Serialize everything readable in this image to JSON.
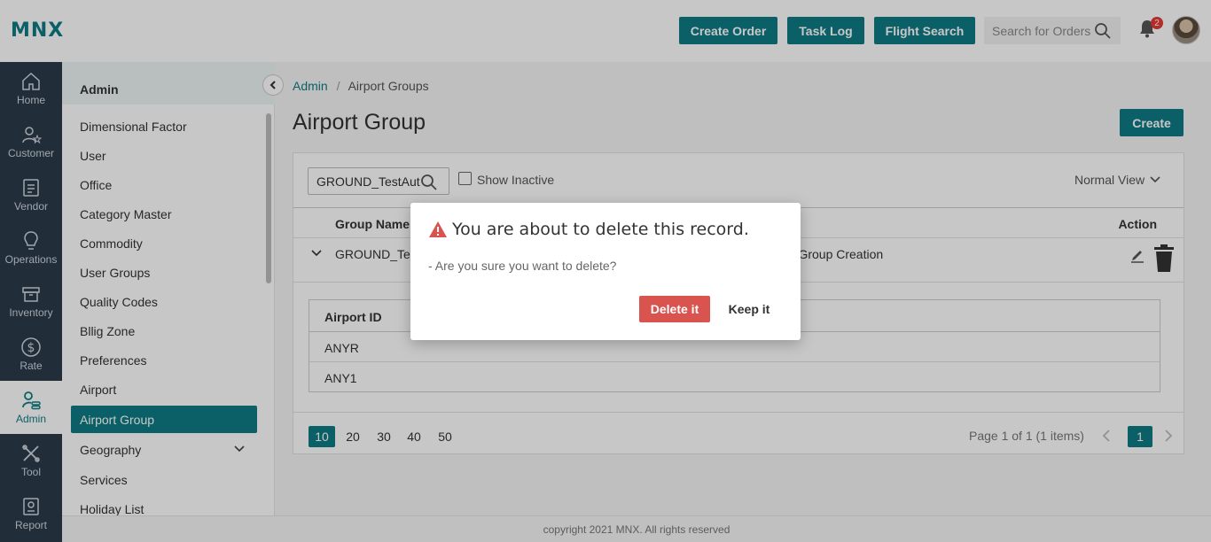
{
  "header": {
    "logo": "MNX",
    "create_order": "Create Order",
    "task_log": "Task Log",
    "flight_search": "Flight Search",
    "search_placeholder": "Search for Orders",
    "notif_count": "2"
  },
  "nav": [
    {
      "label": "Home",
      "icon": "home-icon"
    },
    {
      "label": "Customer",
      "icon": "customer-icon"
    },
    {
      "label": "Vendor",
      "icon": "vendor-icon"
    },
    {
      "label": "Operations",
      "icon": "lightbulb-icon"
    },
    {
      "label": "Inventory",
      "icon": "inventory-icon"
    },
    {
      "label": "Rate",
      "icon": "dollar-icon"
    },
    {
      "label": "Admin",
      "icon": "admin-icon"
    },
    {
      "label": "Tool",
      "icon": "tools-icon"
    },
    {
      "label": "Report",
      "icon": "report-icon"
    }
  ],
  "sidebar": {
    "title": "Admin",
    "items": [
      "Dimensional Factor",
      "User",
      "Office",
      "Category Master",
      "Commodity",
      "User Groups",
      "Quality Codes",
      "Bllig Zone",
      "Preferences",
      "Airport",
      "Airport Group",
      "Geography",
      "Services",
      "Holiday List"
    ]
  },
  "breadcrumb": {
    "root": "Admin",
    "sep": "/",
    "current": "Airport Groups"
  },
  "page": {
    "title": "Airport Group",
    "create": "Create"
  },
  "filter": {
    "value": "GROUND_TestAuto",
    "show_inactive": "Show Inactive",
    "view": "Normal View"
  },
  "grid": {
    "col_group": "Group Name",
    "col_action": "Action",
    "row": {
      "name": "GROUND_Tes",
      "desc": "rt Group Creation"
    },
    "sub": {
      "header": "Airport ID",
      "rows": [
        "ANYR",
        "ANY1"
      ]
    }
  },
  "pager": {
    "sizes": [
      "10",
      "20",
      "30",
      "40",
      "50"
    ],
    "info": "Page 1 of 1 (1 items)",
    "page": "1"
  },
  "footer": "copyright 2021 MNX. All rights reserved",
  "modal": {
    "title": "You are about to delete this record.",
    "message": "- Are you sure you want to delete?",
    "delete": "Delete it",
    "keep": "Keep it"
  },
  "colors": {
    "accent": "#0f7c85",
    "danger": "#d9534f",
    "nav_bg": "#2b3a4a"
  }
}
